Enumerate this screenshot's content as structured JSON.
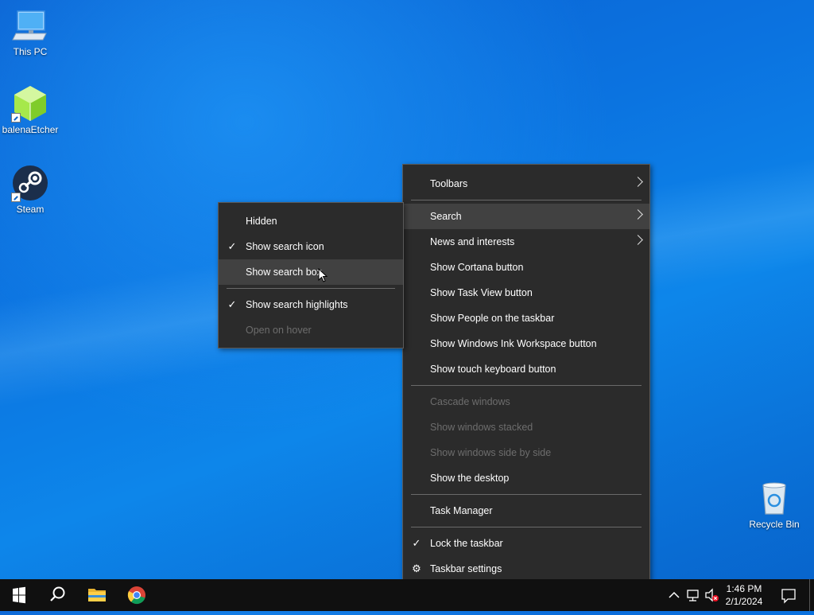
{
  "desktop": {
    "icons": [
      {
        "label": "This PC",
        "icon": "this-pc-icon"
      },
      {
        "label": "balenaEtcher",
        "icon": "balena-etcher-icon"
      },
      {
        "label": "Steam",
        "icon": "steam-icon"
      },
      {
        "label": "Recycle Bin",
        "icon": "recycle-bin-icon"
      }
    ]
  },
  "taskbar_menu": {
    "items": [
      {
        "label": "Toolbars"
      },
      {
        "label": "Search"
      },
      {
        "label": "News and interests"
      },
      {
        "label": "Show Cortana button"
      },
      {
        "label": "Show Task View button"
      },
      {
        "label": "Show People on the taskbar"
      },
      {
        "label": "Show Windows Ink Workspace button"
      },
      {
        "label": "Show touch keyboard button"
      },
      {
        "label": "Cascade windows"
      },
      {
        "label": "Show windows stacked"
      },
      {
        "label": "Show windows side by side"
      },
      {
        "label": "Show the desktop"
      },
      {
        "label": "Task Manager"
      },
      {
        "label": "Lock the taskbar"
      },
      {
        "label": "Taskbar settings"
      }
    ]
  },
  "search_submenu": {
    "items": [
      {
        "label": "Hidden"
      },
      {
        "label": "Show search icon"
      },
      {
        "label": "Show search box"
      },
      {
        "label": "Show search highlights"
      },
      {
        "label": "Open on hover"
      }
    ]
  },
  "taskbar": {
    "time": "1:46 PM",
    "date": "2/1/2024"
  },
  "colors": {
    "menu_bg": "#2b2b2b",
    "menu_hover": "#414141",
    "disabled_text": "#6d6d6d",
    "taskbar_bg": "#101010"
  }
}
